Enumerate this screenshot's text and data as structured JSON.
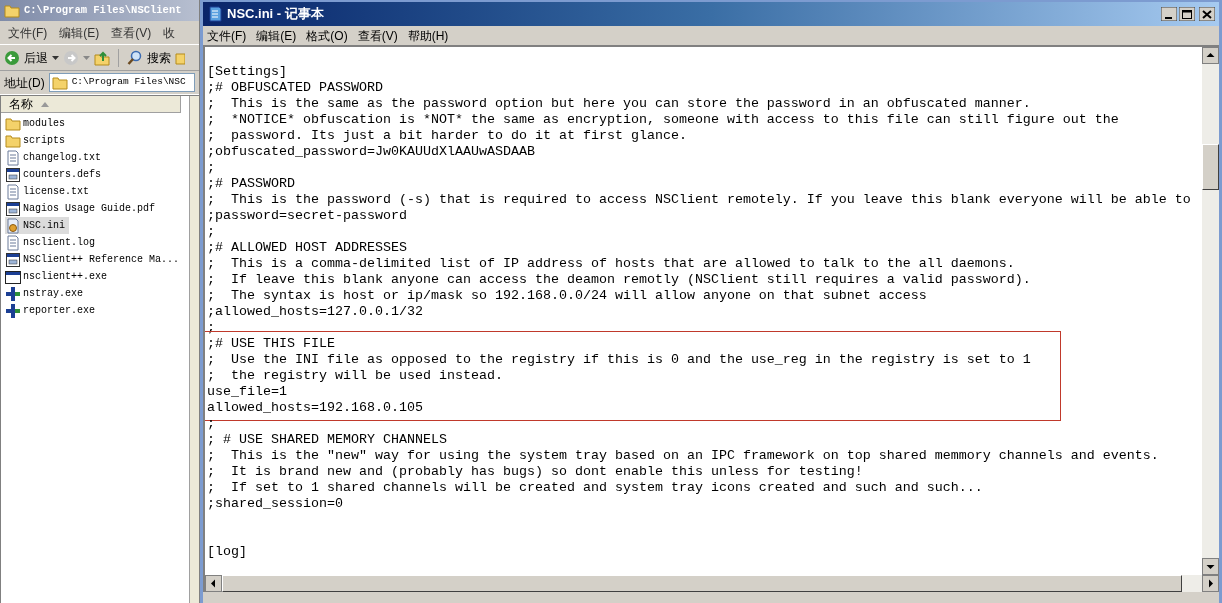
{
  "explorer": {
    "title": "C:\\Program Files\\NSClient",
    "menu": [
      "文件(F)",
      "编辑(E)",
      "查看(V)",
      "收"
    ],
    "toolbar": {
      "back": "后退",
      "search": "搜索"
    },
    "address": {
      "label": "地址(D)",
      "value": "C:\\Program Files\\NSC"
    },
    "column": "名称",
    "files": [
      {
        "name": "modules",
        "kind": "folder",
        "selected": false
      },
      {
        "name": "scripts",
        "kind": "folder",
        "selected": false
      },
      {
        "name": "changelog.txt",
        "kind": "text",
        "selected": false
      },
      {
        "name": "counters.defs",
        "kind": "app",
        "selected": false
      },
      {
        "name": "license.txt",
        "kind": "text",
        "selected": false
      },
      {
        "name": "Nagios Usage Guide.pdf",
        "kind": "app",
        "selected": false
      },
      {
        "name": "NSC.ini",
        "kind": "ini",
        "selected": true
      },
      {
        "name": "nsclient.log",
        "kind": "text",
        "selected": false
      },
      {
        "name": "NSClient++ Reference Ma...",
        "kind": "app",
        "selected": false
      },
      {
        "name": "nsclient++.exe",
        "kind": "window",
        "selected": false
      },
      {
        "name": "nstray.exe",
        "kind": "cross",
        "selected": false
      },
      {
        "name": "reporter.exe",
        "kind": "cross",
        "selected": false
      }
    ]
  },
  "notepad": {
    "title": "NSC.ini - 记事本",
    "menu": [
      "文件(F)",
      "编辑(E)",
      "格式(O)",
      "查看(V)",
      "帮助(H)"
    ],
    "blocks": [
      {
        "highlighted": false,
        "lines": [
          "[Settings]",
          ";# OBFUSCATED PASSWORD",
          ";  This is the same as the password option but here you can store the password in an obfuscated manner.",
          ";  *NOTICE* obfuscation is *NOT* the same as encryption, someone with access to this file can still figure out the",
          ";  password. Its just a bit harder to do it at first glance.",
          ";obfuscated_password=Jw0KAUUdXlAAUwASDAAB",
          ";",
          ";# PASSWORD",
          ";  This is the password (-s) that is required to access NSClient remotely. If you leave this blank everyone will be able to",
          ";password=secret-password",
          ";",
          ";# ALLOWED HOST ADDRESSES",
          ";  This is a comma-delimited list of IP address of hosts that are allowed to talk to the all daemons.",
          ";  If leave this blank anyone can access the deamon remotly (NSClient still requires a valid password).",
          ";  The syntax is host or ip/mask so 192.168.0.0/24 will allow anyone on that subnet access",
          ";allowed_hosts=127.0.0.1/32",
          ";"
        ]
      },
      {
        "highlighted": true,
        "lines": [
          ";# USE THIS FILE",
          ";  Use the INI file as opposed to the registry if this is 0 and the use_reg in the registry is set to 1",
          ";  the registry will be used instead.",
          "use_file=1",
          "allowed_hosts=192.168.0.105"
        ]
      },
      {
        "highlighted": false,
        "lines": [
          ";",
          "; # USE SHARED MEMORY CHANNELS",
          ";  This is the \"new\" way for using the system tray based on an IPC framework on top shared memmory channels and events.",
          ";  It is brand new and (probably has bugs) so dont enable this unless for testing!",
          ";  If set to 1 shared channels will be created and system tray icons created and such and such...",
          ";shared_session=0"
        ]
      },
      {
        "highlighted": false,
        "lines": [
          "[log]"
        ]
      }
    ]
  }
}
